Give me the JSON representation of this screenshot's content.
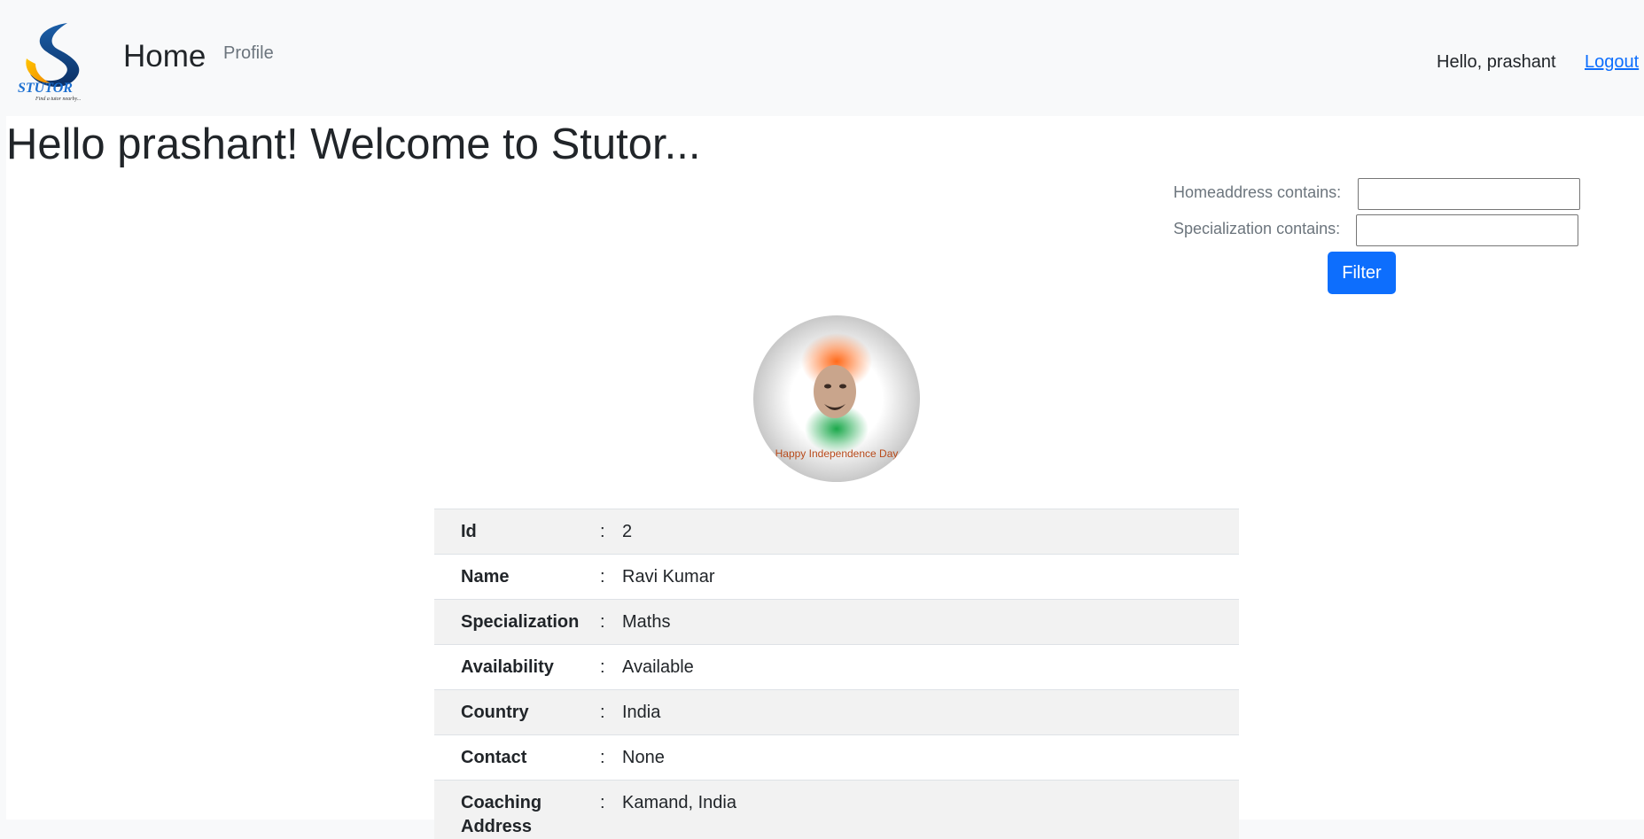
{
  "nav": {
    "brand_text": "STUTOR",
    "brand_tagline": "Find a tutor nearby...",
    "home_label": "Home",
    "profile_label": "Profile",
    "greeting": "Hello, prashant",
    "logout_label": "Logout"
  },
  "welcome": "Hello prashant! Welcome to Stutor...",
  "filter": {
    "homeaddress_label": "Homeaddress contains:",
    "homeaddress_value": "",
    "specialization_label": "Specialization contains:",
    "specialization_value": "",
    "button_label": "Filter"
  },
  "avatar": {
    "caption": "Happy Independence Day"
  },
  "tutor": {
    "rows": [
      {
        "label": "Id",
        "sep": ":",
        "value": "2"
      },
      {
        "label": "Name",
        "sep": ":",
        "value": "Ravi Kumar"
      },
      {
        "label": "Specialization",
        "sep": ":",
        "value": "Maths"
      },
      {
        "label": "Availability",
        "sep": ":",
        "value": "Available"
      },
      {
        "label": "Country",
        "sep": ":",
        "value": "India"
      },
      {
        "label": "Contact",
        "sep": ":",
        "value": "None"
      },
      {
        "label": "Coaching Address",
        "sep": ":",
        "value": "Kamand, India"
      }
    ]
  },
  "colors": {
    "accent": "#0d6efd",
    "navbar_bg": "#f8f9fa",
    "stripe": "#f2f2f2"
  }
}
